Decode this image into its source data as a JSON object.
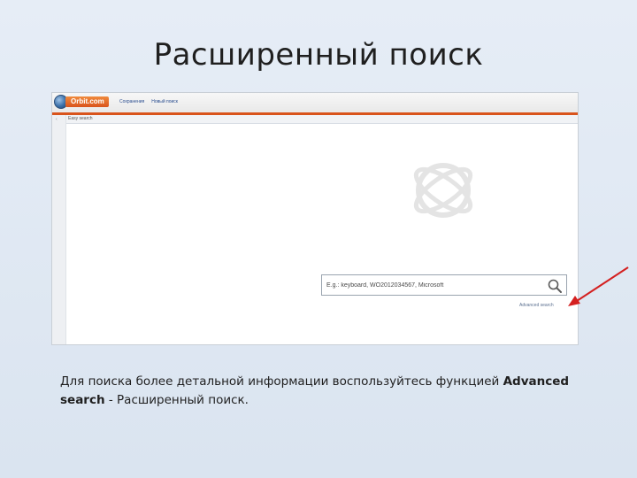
{
  "slide": {
    "title": "Расширенный поиск",
    "caption_part1": "Для поиска более детальной информации воспользуйтесь функцией ",
    "caption_bold1": "Advanced search",
    "caption_part2": " - Расширенный поиск."
  },
  "app": {
    "logo_text": "Orbit.com",
    "nav": {
      "link1": "Сохранения",
      "link2": "Новый поиск"
    },
    "subbar_label": "Easy search",
    "search": {
      "placeholder": "E.g.: keyboard, WO2012034567, Microsoft"
    },
    "advanced_search_label": "Advanced search"
  },
  "colors": {
    "accent_orange": "#d9541c",
    "link_blue": "#2a4d8f",
    "arrow_red": "#d42020"
  },
  "icons": {
    "logo": "globe-icon",
    "search": "magnifier-icon",
    "watermark": "orbit-watermark-icon",
    "annotation": "red-arrow"
  }
}
